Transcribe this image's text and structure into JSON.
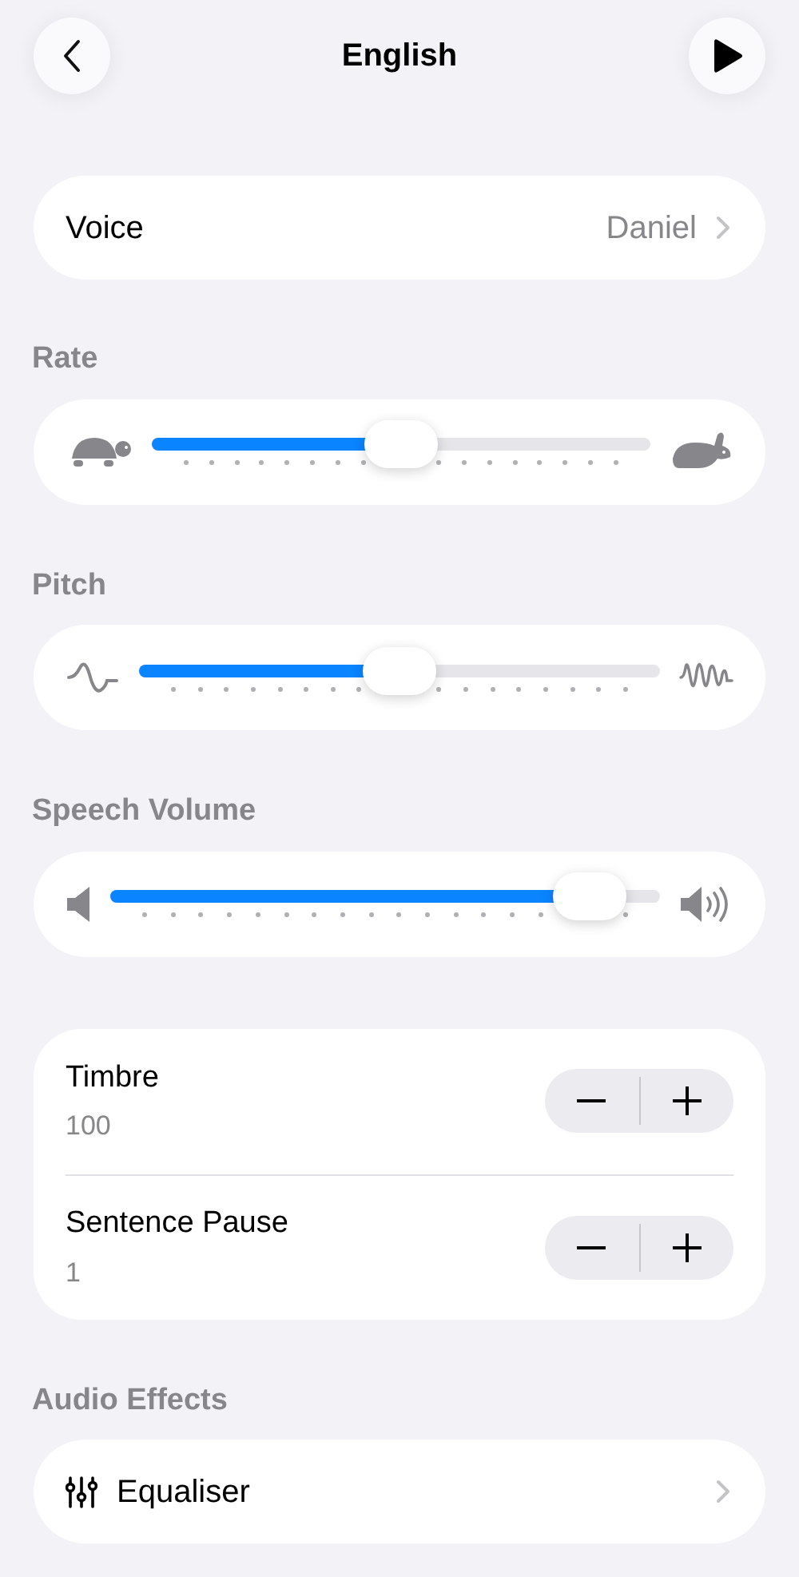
{
  "header": {
    "title": "English"
  },
  "voice": {
    "label": "Voice",
    "value": "Daniel"
  },
  "sliders": [
    {
      "kind": "rate",
      "label": "Rate",
      "level": 0.5
    },
    {
      "kind": "pitch",
      "label": "Pitch",
      "level": 0.5
    },
    {
      "kind": "volume",
      "label": "Speech Volume",
      "level": 0.93
    }
  ],
  "steppers": [
    {
      "label": "Timbre",
      "value": "100"
    },
    {
      "label": "Sentence Pause",
      "value": "1"
    }
  ],
  "audio_effects": {
    "label": "Audio Effects",
    "items": [
      {
        "label": "Equaliser"
      }
    ]
  }
}
